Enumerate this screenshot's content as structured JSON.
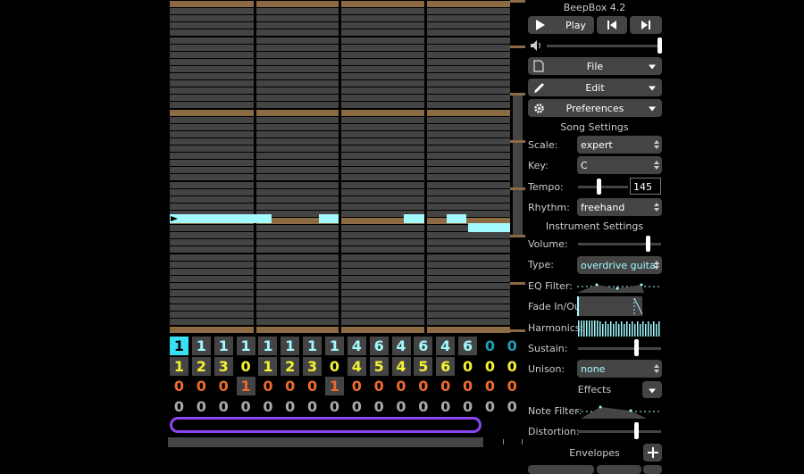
{
  "app": {
    "title": "BeepBox 4.2"
  },
  "transport": {
    "play_label": "Play"
  },
  "menus": {
    "file": "File",
    "edit": "Edit",
    "preferences": "Preferences"
  },
  "song_settings": {
    "header": "Song Settings",
    "scale_label": "Scale:",
    "scale_value": "expert",
    "key_label": "Key:",
    "key_value": "C",
    "tempo_label": "Tempo:",
    "tempo_value": "145",
    "rhythm_label": "Rhythm:",
    "rhythm_value": "freehand"
  },
  "instrument_settings": {
    "header": "Instrument Settings",
    "volume_label": "Volume:",
    "type_label": "Type:",
    "type_value": "overdrive guitar",
    "eq_label": "EQ Filter:",
    "fade_label": "Fade In/Out:",
    "harmonics_label": "Harmonics:",
    "sustain_label": "Sustain:",
    "unison_label": "Unison:",
    "unison_value": "none",
    "effects_label": "Effects",
    "note_filter_label": "Note Filter:",
    "distortion_label": "Distortion:",
    "envelopes_label": "Envelopes"
  },
  "pattern_grid": {
    "rows": [
      {
        "color": "#a2faff",
        "cells": [
          "1",
          "1",
          "1",
          "1",
          "1",
          "1",
          "1",
          "1",
          "4",
          "6",
          "4",
          "6",
          "4",
          "6",
          "0",
          "0"
        ]
      },
      {
        "color": "#f5f233",
        "cells": [
          "1",
          "2",
          "3",
          "0",
          "1",
          "2",
          "3",
          "0",
          "4",
          "5",
          "4",
          "5",
          "6",
          "0",
          "0",
          "0"
        ]
      },
      {
        "color": "#ef6a2d",
        "cells": [
          "0",
          "0",
          "0",
          "1",
          "0",
          "0",
          "0",
          "1",
          "0",
          "0",
          "0",
          "0",
          "0",
          "0",
          "0",
          "0"
        ]
      },
      {
        "color": "#aaaaaa",
        "cells": [
          "0",
          "0",
          "0",
          "0",
          "0",
          "0",
          "0",
          "0",
          "0",
          "0",
          "0",
          "0",
          "0",
          "0",
          "0",
          "0"
        ]
      }
    ],
    "dim_color": "#1aa0b8"
  },
  "colors": {
    "accent": "#a2faff",
    "note": "#a2faff",
    "root": "#8c6a43",
    "loop": "#8b45f2"
  },
  "icons": [
    "play-icon",
    "skip-back-icon",
    "skip-forward-icon",
    "speaker-icon",
    "file-icon",
    "pencil-icon",
    "gear-icon",
    "plus-icon"
  ]
}
